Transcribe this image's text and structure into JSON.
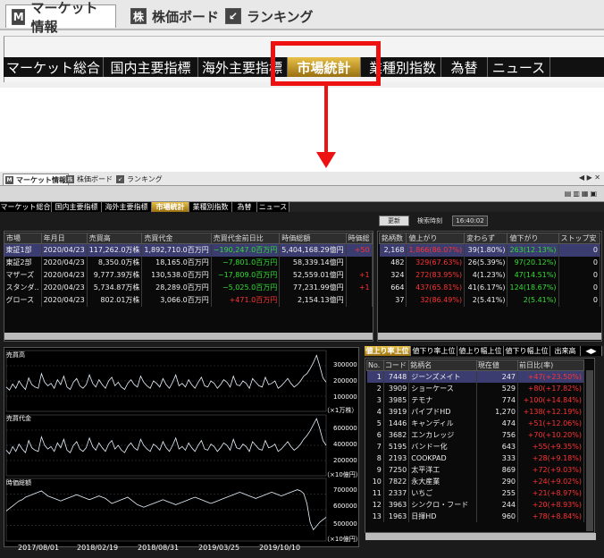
{
  "top": {
    "main_tabs": [
      {
        "label": "マーケット情報",
        "icon": "M"
      },
      {
        "label": "株価ボード",
        "icon": "株"
      },
      {
        "label": "ランキング",
        "icon": "↙"
      }
    ],
    "sub_tabs": [
      "マーケット総合",
      "国内主要指標",
      "海外主要指標",
      "市場統計",
      "業種別指数",
      "為替",
      "ニュース"
    ]
  },
  "window": {
    "tabs": [
      {
        "label": "マーケット情報",
        "icon": "M"
      },
      {
        "label": "株価ボード",
        "icon": "株"
      },
      {
        "label": "ランキング",
        "icon": "↙"
      }
    ],
    "tools": "◀ ▶ ✕",
    "sub_tabs": [
      "マーケット総合",
      "国内主要指標",
      "海外主要指標",
      "市場統計",
      "業種別指数",
      "為替",
      "ニュース"
    ],
    "update_button": "更新",
    "search_time_label": "検索時刻",
    "search_time": "16:40:02",
    "market_table": {
      "headers": [
        "市場",
        "年月日",
        "売買高",
        "売買代金",
        "売買代金前日比",
        "時価総額",
        "時価総"
      ],
      "rows": [
        [
          "東証1部",
          "2020/04/23",
          "117,262.0万株",
          "1,892,710.0百万円",
          "−190,247.0百万円",
          "5,404,168.29億円",
          "+50"
        ],
        [
          "東証2部",
          "2020/04/23",
          "8,350.0万株",
          "18,165.0百万円",
          "−7,801.0百万円",
          "58,339.14億円",
          ""
        ],
        [
          "マザーズ",
          "2020/04/23",
          "9,777.39万株",
          "130,538.0百万円",
          "−17,809.0百万円",
          "52,559.01億円",
          "+1"
        ],
        [
          "スタンダ..",
          "2020/04/23",
          "5,734.87万株",
          "28,289.0百万円",
          "−5,025.0百万円",
          "77,231.99億円",
          "+1"
        ],
        [
          "グロース",
          "2020/04/23",
          "802.01万株",
          "3,066.0百万円",
          "+471.0百万円",
          "2,154.13億円",
          ""
        ]
      ]
    },
    "breadth_table": {
      "headers": [
        "銘柄数",
        "値上がり",
        "変わらず",
        "値下がり",
        "ストップ安"
      ],
      "rows": [
        [
          "2,168",
          "1,866(86.07%)",
          "39(1.80%)",
          "263(12.13%)",
          "0"
        ],
        [
          "482",
          "329(67.63%)",
          "26(5.39%)",
          "97(20.12%)",
          "0"
        ],
        [
          "324",
          "272(83.95%)",
          "4(1.23%)",
          "47(14.51%)",
          "0"
        ],
        [
          "664",
          "437(65.81%)",
          "41(6.17%)",
          "124(18.67%)",
          "0"
        ],
        [
          "37",
          "32(86.49%)",
          "2(5.41%)",
          "2(5.41%)",
          "0"
        ]
      ]
    },
    "charts": [
      {
        "name": "売買高",
        "ticks": [
          "300000",
          "200000",
          "100000"
        ],
        "unit": "（×1万株）",
        "values": [
          40,
          35,
          45,
          38,
          50,
          42,
          36,
          55,
          44,
          40,
          38,
          62,
          48,
          42,
          46,
          38,
          52,
          44,
          58,
          40,
          36,
          48,
          54,
          42,
          38,
          44,
          60,
          46,
          40,
          52,
          44,
          38,
          50,
          56,
          42,
          48,
          40,
          36,
          46,
          52,
          44,
          40,
          58,
          48,
          42,
          38,
          50,
          46,
          40,
          54,
          44,
          38,
          48,
          60,
          42,
          46,
          40,
          52,
          44,
          38,
          48,
          56,
          42,
          40,
          50,
          46,
          38,
          44,
          52,
          48,
          40,
          58,
          44,
          42,
          50,
          46,
          38,
          54,
          48,
          42,
          40,
          56,
          44,
          46,
          50,
          38,
          42,
          48,
          54,
          46,
          40,
          44,
          50,
          58,
          62,
          70,
          80,
          92,
          75,
          55,
          48
        ]
      },
      {
        "name": "売買代金",
        "ticks": [
          "600000",
          "400000",
          "200000"
        ],
        "unit": "（×10億円）",
        "values": [
          42,
          36,
          48,
          40,
          52,
          44,
          38,
          58,
          46,
          42,
          40,
          64,
          50,
          44,
          48,
          40,
          54,
          46,
          60,
          42,
          38,
          50,
          56,
          44,
          40,
          46,
          62,
          48,
          42,
          54,
          46,
          40,
          52,
          58,
          44,
          50,
          42,
          38,
          48,
          54,
          46,
          42,
          60,
          50,
          44,
          40,
          52,
          48,
          42,
          56,
          46,
          40,
          50,
          62,
          44,
          48,
          42,
          54,
          46,
          40,
          50,
          58,
          44,
          42,
          52,
          48,
          40,
          46,
          54,
          50,
          42,
          60,
          46,
          44,
          52,
          48,
          40,
          56,
          50,
          44,
          42,
          58,
          46,
          48,
          52,
          40,
          44,
          50,
          56,
          48,
          42,
          46,
          52,
          60,
          66,
          74,
          84,
          94,
          78,
          58,
          50
        ]
      },
      {
        "name": "時価総額",
        "ticks": [
          "700000",
          "600000",
          "500000"
        ],
        "unit": "（×10億円）",
        "values": [
          48,
          52,
          56,
          60,
          64,
          66,
          70,
          72,
          74,
          76,
          78,
          80,
          76,
          72,
          70,
          68,
          66,
          64,
          66,
          68,
          70,
          72,
          74,
          72,
          70,
          68,
          66,
          68,
          70,
          72,
          70,
          68,
          64,
          60,
          62,
          64,
          66,
          68,
          70,
          66,
          62,
          58,
          56,
          54,
          56,
          58,
          60,
          62,
          64,
          66,
          64,
          62,
          60,
          58,
          60,
          62,
          64,
          66,
          68,
          70,
          68,
          66,
          64,
          62,
          60,
          62,
          64,
          66,
          68,
          70,
          72,
          74,
          76,
          78,
          76,
          74,
          72,
          70,
          68,
          70,
          72,
          74,
          76,
          78,
          76,
          74,
          72,
          74,
          76,
          78,
          80,
          82,
          80,
          76,
          60,
          30,
          18,
          24,
          30,
          34,
          38
        ]
      }
    ],
    "x_dates": [
      "2017/08/01",
      "2018/02/19",
      "2018/08/31",
      "2019/03/25",
      "2019/10/10"
    ],
    "rank_tabs": [
      "値上り率上位",
      "値下り率上位",
      "値上り幅上位",
      "値下り幅上位",
      "出来高"
    ],
    "rank_table": {
      "headers": [
        "No.",
        "コード",
        "銘柄名",
        "現在値",
        "前日比(率)"
      ],
      "rows": [
        [
          "1",
          "7448",
          "ジーンズメイト",
          "247",
          "+47(+23.50%)"
        ],
        [
          "2",
          "3909",
          "ショーケース",
          "529",
          "+80(+17.82%)"
        ],
        [
          "3",
          "3985",
          "テモナ",
          "774",
          "+100(+14.84%)"
        ],
        [
          "4",
          "3919",
          "パイプドHD",
          "1,270",
          "+138(+12.19%)"
        ],
        [
          "5",
          "1446",
          "キャンディル",
          "474",
          "+51(+12.06%)"
        ],
        [
          "6",
          "3682",
          "エンカレッジ",
          "756",
          "+70(+10.20%)"
        ],
        [
          "7",
          "5195",
          "バンドー化",
          "643",
          "+55(+9.35%)"
        ],
        [
          "8",
          "2193",
          "COOKPAD",
          "333",
          "+28(+9.18%)"
        ],
        [
          "9",
          "7250",
          "太平洋工",
          "869",
          "+72(+9.03%)"
        ],
        [
          "10",
          "7822",
          "永大産業",
          "290",
          "+24(+9.02%)"
        ],
        [
          "11",
          "2337",
          "いちご",
          "255",
          "+21(+8.97%)"
        ],
        [
          "12",
          "3963",
          "シンクロ・フード",
          "244",
          "+20(+8.93%)"
        ],
        [
          "13",
          "1963",
          "日揮HD",
          "960",
          "+78(+8.84%)"
        ]
      ]
    }
  }
}
